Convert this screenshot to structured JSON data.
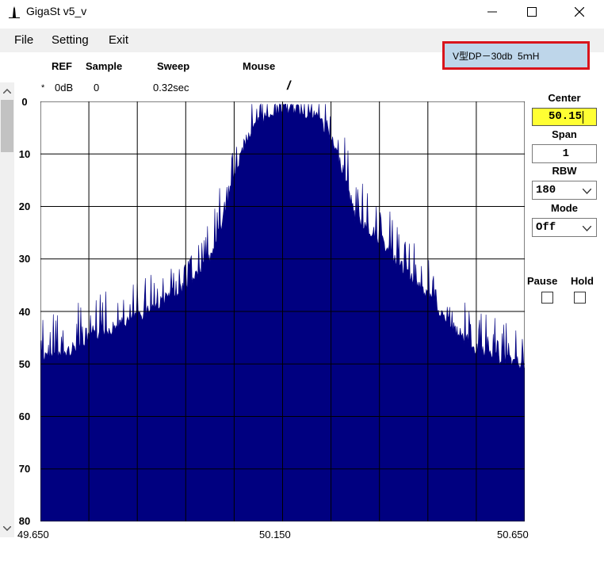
{
  "window": {
    "title": "GigaSt v5_v"
  },
  "menu": {
    "file": "File",
    "setting": "Setting",
    "exit": "Exit"
  },
  "label_box": {
    "text": "V型DP－30db  5ｍH"
  },
  "header": {
    "ref": {
      "label": "REF",
      "value": "0dB",
      "marker": "*"
    },
    "sample": {
      "label": "Sample",
      "value": "0"
    },
    "sweep": {
      "label": "Sweep",
      "value": "0.32sec"
    },
    "mouse": {
      "label": "Mouse",
      "value": "/"
    }
  },
  "controls": {
    "center": {
      "label": "Center",
      "value": "50.15"
    },
    "span": {
      "label": "Span",
      "value": "1"
    },
    "rbw": {
      "label": "RBW",
      "value": "180"
    },
    "mode": {
      "label": "Mode",
      "value": "Off"
    },
    "pause": {
      "label": "Pause"
    },
    "hold": {
      "label": "Hold"
    }
  },
  "chart_data": {
    "type": "area",
    "xlim": [
      49.65,
      50.65
    ],
    "ylim": [
      0,
      80
    ],
    "y_inverted": true,
    "grid": true,
    "yticks": [
      "0",
      "10",
      "20",
      "30",
      "40",
      "50",
      "60",
      "70",
      "80"
    ],
    "xticks": [
      "49.650",
      "50.150",
      "50.650"
    ],
    "series": [
      {
        "color": "#000080",
        "x": [
          49.65,
          49.7,
          49.75,
          49.8,
          49.85,
          49.9,
          49.95,
          50.0,
          50.025,
          50.05,
          50.075,
          50.1,
          50.125,
          50.15,
          50.175,
          50.2,
          50.225,
          50.25,
          50.275,
          50.3,
          50.35,
          50.4,
          50.45,
          50.5,
          50.55,
          50.6,
          50.65
        ],
        "y": [
          49,
          48,
          45,
          43,
          41,
          38,
          35,
          30,
          23,
          14,
          7,
          4,
          2,
          1.5,
          1.5,
          2,
          3,
          7,
          13,
          22,
          26,
          32,
          37,
          43,
          47,
          49,
          50
        ]
      }
    ],
    "colors": {
      "trace": "#000080",
      "grid": "#000000",
      "background": "#ffffff"
    }
  }
}
